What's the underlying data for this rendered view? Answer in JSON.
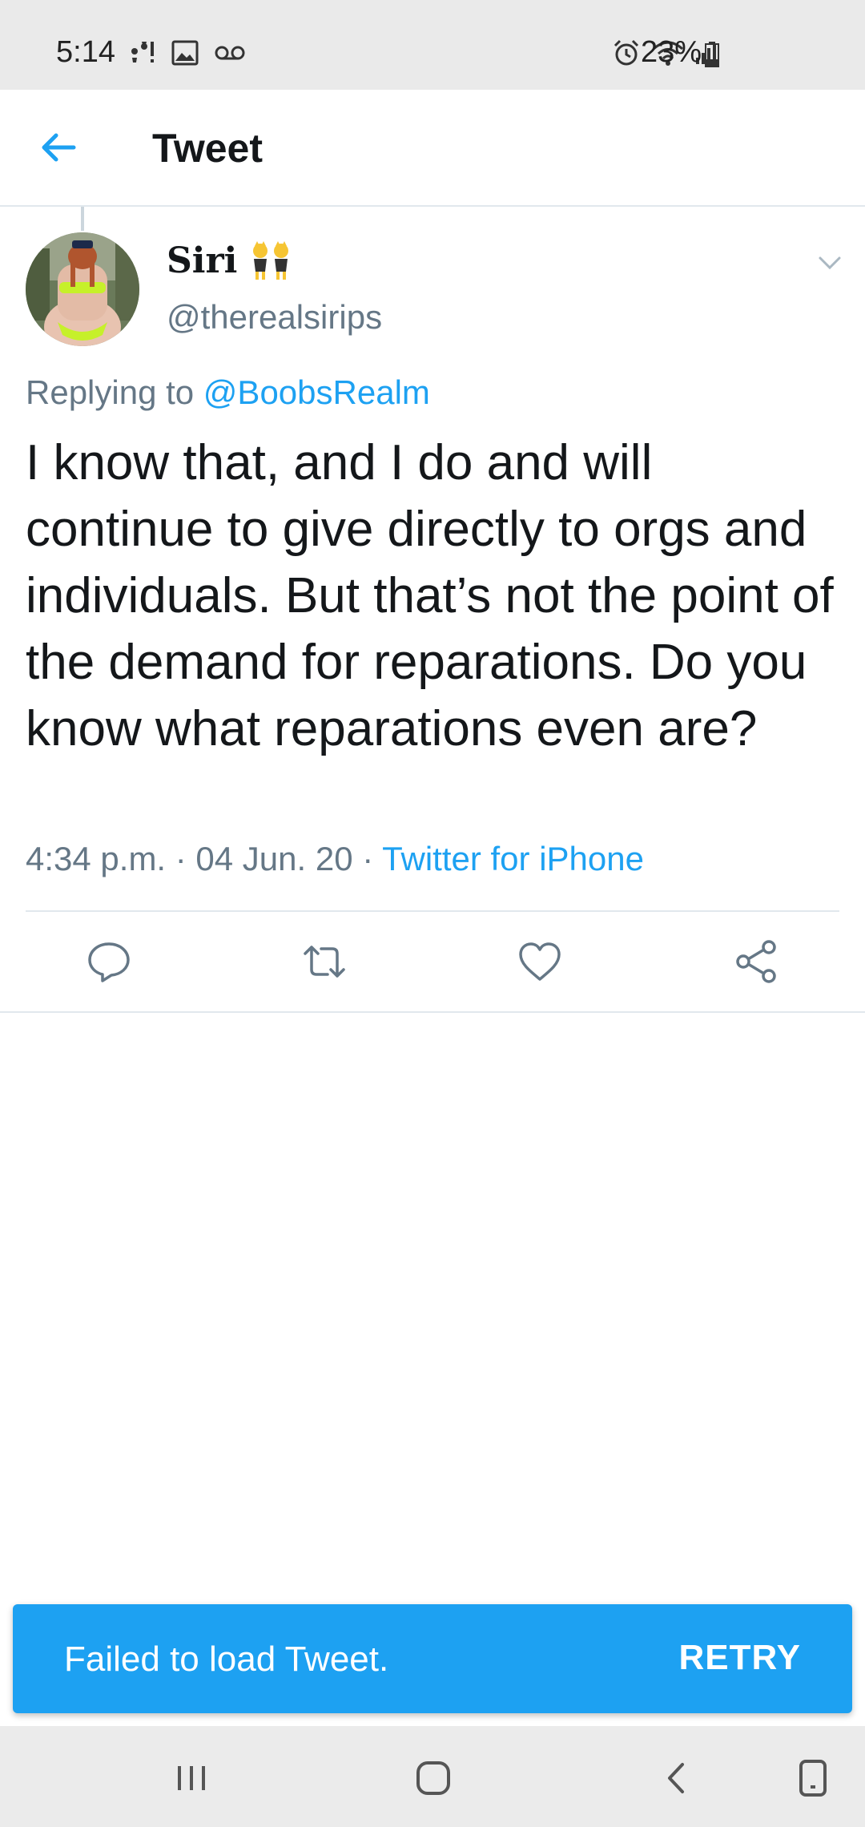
{
  "status_bar": {
    "time": "5:14",
    "battery": "23%",
    "icons_left": [
      "notification-icon",
      "image-icon",
      "voicemail-icon"
    ],
    "icons_right": [
      "alarm-icon",
      "wifi-icon",
      "signal-icon",
      "battery-icon"
    ]
  },
  "app_bar": {
    "title": "Tweet"
  },
  "tweet": {
    "display_name": "Siri",
    "handle": "@therealsirips",
    "replying_prefix": "Replying to",
    "replying_to": "@BoobsRealm",
    "text": "I know that, and I do and will continue to give directly to orgs and individuals. But that’s not the point of the demand for reparations. Do you know what reparations even are?",
    "timestamp": "4:34 p.m. · 04 Jun. 20 · ",
    "source": "Twitter for iPhone"
  },
  "actions": [
    "reply-icon",
    "retweet-icon",
    "like-icon",
    "share-icon"
  ],
  "snackbar": {
    "message": "Failed to load Tweet.",
    "action": "RETRY"
  },
  "colors": {
    "accent": "#1da1f2",
    "secondary_text": "#657786",
    "divider": "#e1e8ed"
  }
}
